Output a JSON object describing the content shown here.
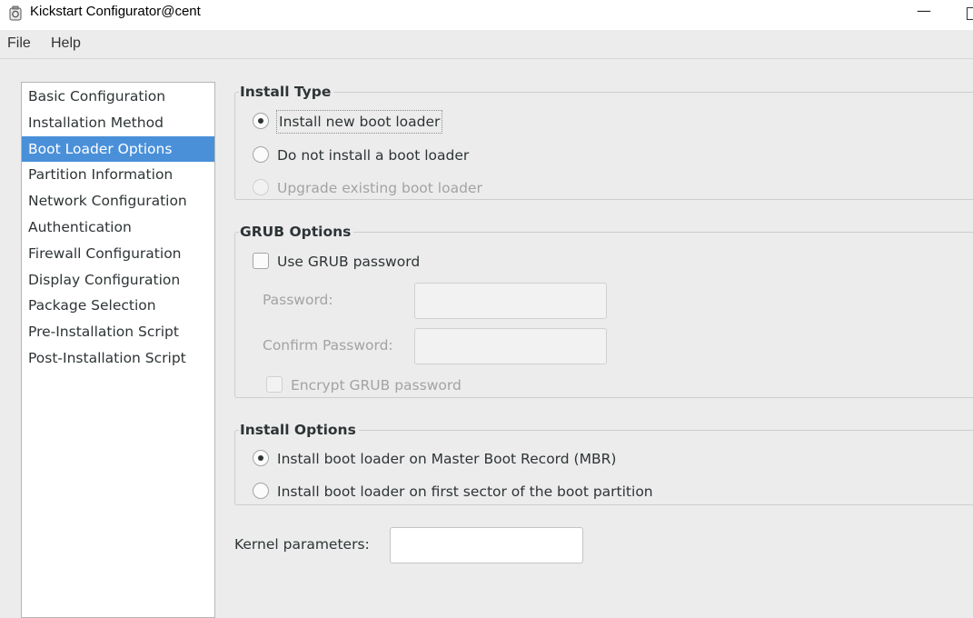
{
  "window": {
    "title": "Kickstart Configurator@cent"
  },
  "menu": [
    "File",
    "Help"
  ],
  "sidebar": {
    "items": [
      "Basic Configuration",
      "Installation Method",
      "Boot Loader Options",
      "Partition Information",
      "Network Configuration",
      "Authentication",
      "Firewall Configuration",
      "Display Configuration",
      "Package Selection",
      "Pre-Installation Script",
      "Post-Installation Script"
    ],
    "selected": "Boot Loader Options"
  },
  "install_type": {
    "title": "Install Type",
    "options": [
      {
        "label": "Install new boot loader",
        "checked": true
      },
      {
        "label": "Do not install a boot loader",
        "checked": false
      },
      {
        "label": "Upgrade existing boot loader",
        "checked": false,
        "disabled": true
      }
    ]
  },
  "grub": {
    "title": "GRUB Options",
    "use_password": {
      "label": "Use GRUB password",
      "checked": false
    },
    "password_label": "Password:",
    "password_value": "",
    "confirm_label": "Confirm Password:",
    "confirm_value": "",
    "encrypt": {
      "label": "Encrypt GRUB password",
      "checked": false,
      "disabled": true
    }
  },
  "install_options": {
    "title": "Install Options",
    "options": [
      {
        "label": "Install boot loader on Master Boot Record (MBR)",
        "checked": true
      },
      {
        "label": "Install boot loader on first sector of the boot partition",
        "checked": false
      }
    ]
  },
  "kernel": {
    "label": "Kernel parameters:",
    "value": ""
  }
}
